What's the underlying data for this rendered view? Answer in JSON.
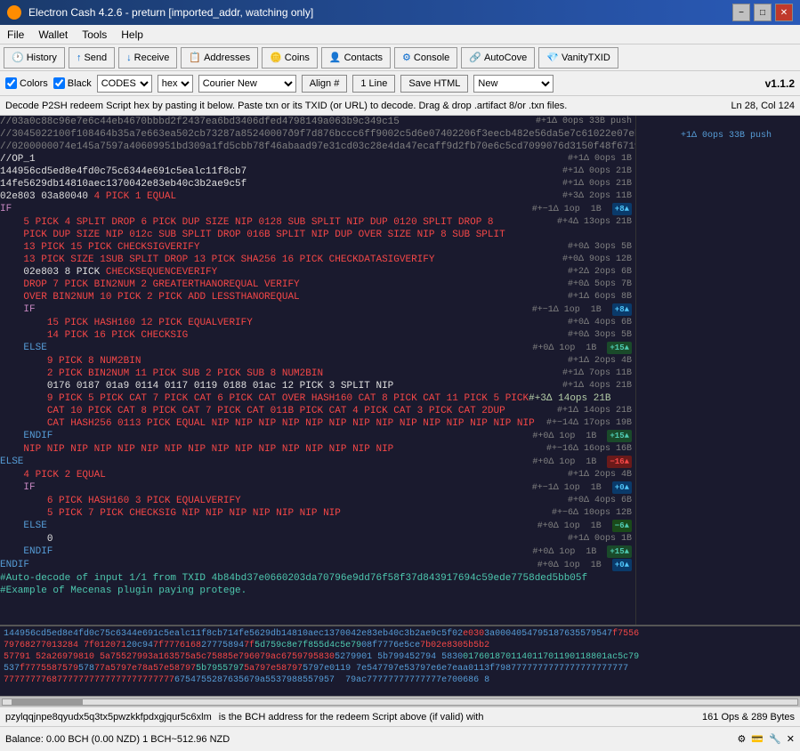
{
  "titlebar": {
    "title": "Electron Cash 4.2.6 - preturn  [imported_addr, watching only]",
    "min_btn": "−",
    "max_btn": "□",
    "close_btn": "✕"
  },
  "menubar": {
    "items": [
      "File",
      "Wallet",
      "Tools",
      "Help"
    ]
  },
  "toolbar": {
    "history_label": "History",
    "send_label": "Send",
    "receive_label": "Receive",
    "addresses_label": "Addresses",
    "coins_label": "Coins",
    "contacts_label": "Contacts",
    "console_label": "Console",
    "autocove_label": "AutoCove",
    "vanitytxid_label": "VanityTXID"
  },
  "optionsbar": {
    "colors_label": "Colors",
    "black_label": "Black",
    "codes_label": "CODES",
    "hex_label": "hex",
    "font_label": "Courier New",
    "align_label": "Align #",
    "lines_label": "1 Line",
    "savehtml_label": "Save HTML",
    "new_label": "New",
    "version": "v1.1.2"
  },
  "infobar": {
    "text": "Decode P2SH redeem Script hex by pasting it below. Paste txn or its TXID (or URL) to decode. Drag & drop .artifact 8/or .txn files.",
    "position": "Ln 28, Col 124"
  },
  "statusbar": {
    "left": "pzylqqjnpe8qyudx5q3tx5pwzkkfpdxgjqur5c6xlm",
    "middle": "is the BCH address for the redeem Script above (if valid) with",
    "right": "161 Ops & 289 Bytes"
  },
  "addrbar": {
    "balance": "Balance: 0.00 BCH (0.00 NZD) 1 BCH~512.96 NZD"
  }
}
